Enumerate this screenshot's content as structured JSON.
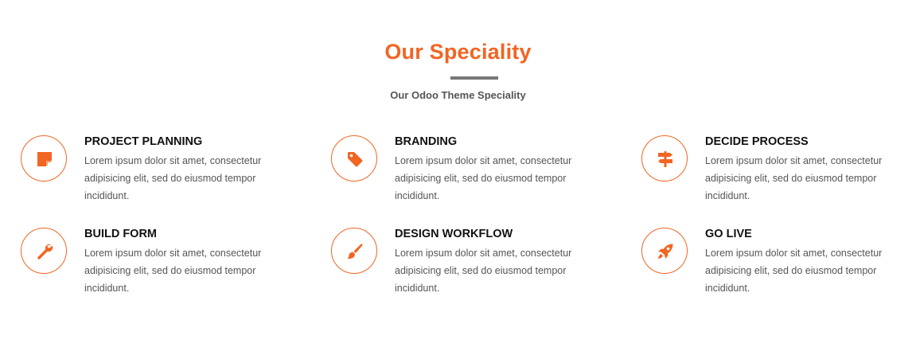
{
  "section": {
    "title": "Our Speciality",
    "subtitle": "Our Odoo Theme Speciality"
  },
  "colors": {
    "accent": "#f26522",
    "divider": "#777777",
    "heading": "#111111",
    "text": "#555555"
  },
  "features": [
    {
      "title": "PROJECT PLANNING",
      "text": "Lorem ipsum dolor sit amet, consectetur adipisicing elit, sed do eiusmod tempor incididunt.",
      "icon": "sticky-note-icon"
    },
    {
      "title": "BRANDING",
      "text": "Lorem ipsum dolor sit amet, consectetur adipisicing elit, sed do eiusmod tempor incididunt.",
      "icon": "tag-icon"
    },
    {
      "title": "DECIDE PROCESS",
      "text": "Lorem ipsum dolor sit amet, consectetur adipisicing elit, sed do eiusmod tempor incididunt.",
      "icon": "signpost-icon"
    },
    {
      "title": "BUILD FORM",
      "text": "Lorem ipsum dolor sit amet, consectetur adipisicing elit, sed do eiusmod tempor incididunt.",
      "icon": "wrench-icon"
    },
    {
      "title": "DESIGN WORKFLOW",
      "text": "Lorem ipsum dolor sit amet, consectetur adipisicing elit, sed do eiusmod tempor incididunt.",
      "icon": "paintbrush-icon"
    },
    {
      "title": "GO LIVE",
      "text": "Lorem ipsum dolor sit amet, consectetur adipisicing elit, sed do eiusmod tempor incididunt.",
      "icon": "rocket-icon"
    }
  ]
}
